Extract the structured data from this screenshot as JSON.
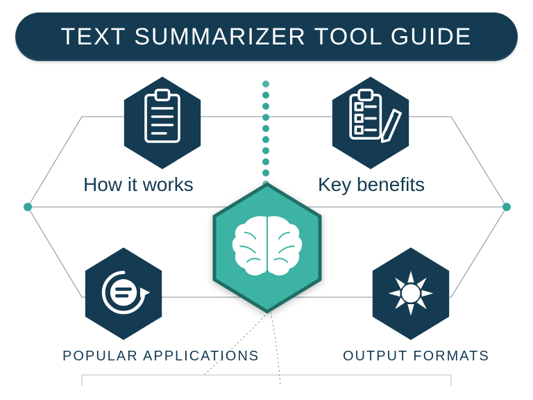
{
  "title": "TEXT SUMMARIZER TOOL GUIDE",
  "sections": {
    "top_left": "How it works",
    "top_right": "Key benefits",
    "bottom_left": "POPULAR APPLICATIONS",
    "bottom_right": "OUTPUT FORMATS"
  },
  "icons": {
    "top_left": "clipboard-document",
    "top_right": "checklist-pencil",
    "bottom_left": "speech-loop",
    "bottom_right": "sun-gear",
    "center": "brain"
  },
  "colors": {
    "dark": "#143b52",
    "teal": "#34a79a",
    "teal_dark": "#1f6e66"
  }
}
